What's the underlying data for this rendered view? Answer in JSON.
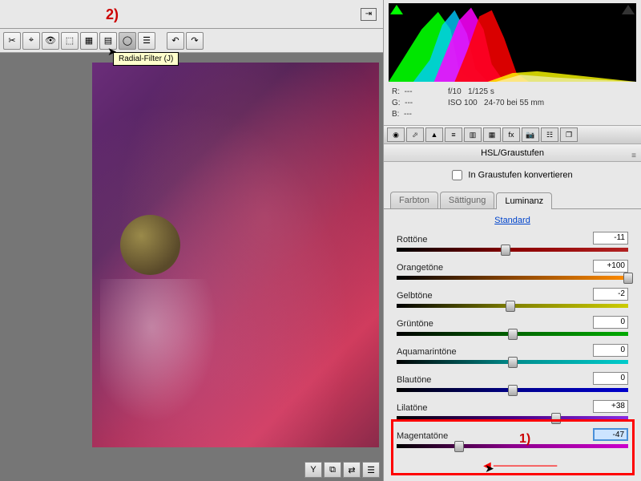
{
  "annotations": {
    "a1": "1)",
    "a2": "2)"
  },
  "toolbar": {
    "tools": [
      "crop",
      "spot",
      "eye",
      "wb",
      "tone",
      "tone2",
      "grad",
      "radial",
      "list",
      "rotate-l",
      "rotate-r"
    ],
    "tooltip": "Radial-Filter (J)"
  },
  "info": {
    "r": "R:",
    "r_val": "---",
    "g": "G:",
    "g_val": "---",
    "b": "B:",
    "b_val": "---",
    "aperture": "f/10",
    "shutter": "1/125 s",
    "iso": "ISO 100",
    "lens": "24-70 bei 55 mm"
  },
  "panel": {
    "title": "HSL/Graustufen",
    "convert_label": "In Graustufen konvertieren",
    "tabs": {
      "hue": "Farbton",
      "sat": "Sättigung",
      "lum": "Luminanz"
    },
    "standard": "Standard"
  },
  "sliders": [
    {
      "label": "Rottöne",
      "value": "-11",
      "pos": 47,
      "grad": "linear-gradient(90deg,#000,#8b0000,#b22222)"
    },
    {
      "label": "Orangetöne",
      "value": "+100",
      "pos": 100,
      "grad": "linear-gradient(90deg,#000,#8b4500,#ff8c00)"
    },
    {
      "label": "Gelbtöne",
      "value": "-2",
      "pos": 49,
      "grad": "linear-gradient(90deg,#000,#808000,#cccc00)"
    },
    {
      "label": "Grüntöne",
      "value": "0",
      "pos": 50,
      "grad": "linear-gradient(90deg,#000,#006400,#00aa00)"
    },
    {
      "label": "Aquamarintöne",
      "value": "0",
      "pos": 50,
      "grad": "linear-gradient(90deg,#000,#008b8b,#00cccc)"
    },
    {
      "label": "Blautöne",
      "value": "0",
      "pos": 50,
      "grad": "linear-gradient(90deg,#000,#00008b,#0000cc)"
    },
    {
      "label": "Lilatöne",
      "value": "+38",
      "pos": 69,
      "grad": "linear-gradient(90deg,#000,#4b0082,#8a2be2)"
    },
    {
      "label": "Magentatöne",
      "value": "-47",
      "pos": 27,
      "grad": "linear-gradient(90deg,#000,#8b008b,#cc00cc)",
      "focus": true
    }
  ]
}
